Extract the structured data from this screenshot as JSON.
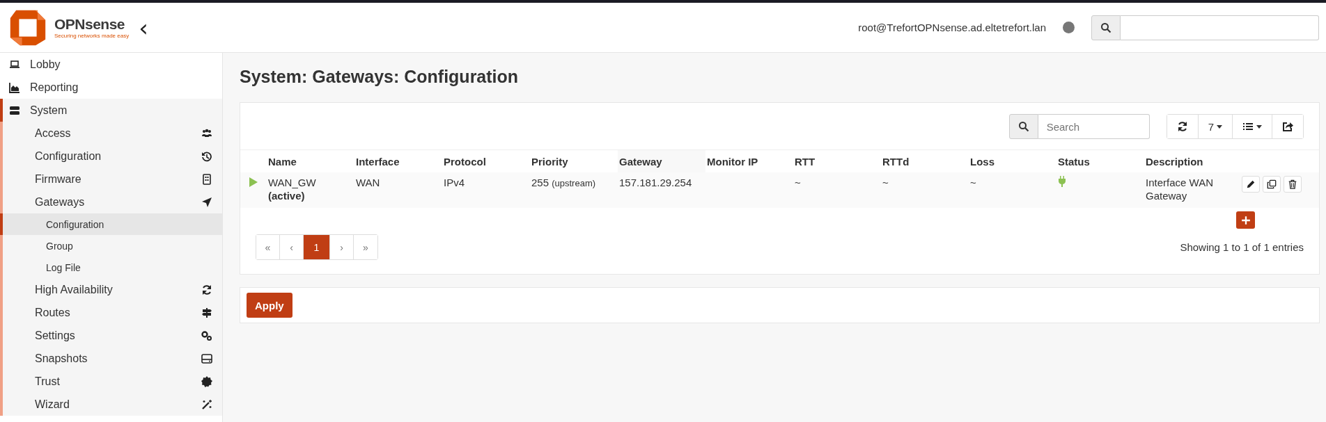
{
  "header": {
    "logo": {
      "name": "OPNsense",
      "tagline": "Securing networks made easy"
    },
    "collapse": "‹",
    "user": "root@TrefortOPNsense.ad.eltetrefort.lan"
  },
  "sidebar": {
    "items": [
      {
        "label": "Lobby",
        "selected": false,
        "expanded": false
      },
      {
        "label": "Reporting",
        "selected": false,
        "expanded": false
      },
      {
        "label": "System",
        "selected": false,
        "expanded": true,
        "children": [
          {
            "label": "Access",
            "selected": false,
            "expanded": false
          },
          {
            "label": "Configuration",
            "selected": false,
            "expanded": false
          },
          {
            "label": "Firmware",
            "selected": false,
            "expanded": false
          },
          {
            "label": "Gateways",
            "selected": false,
            "expanded": true,
            "children": [
              {
                "label": "Configuration",
                "selected": true
              },
              {
                "label": "Group",
                "selected": false
              },
              {
                "label": "Log File",
                "selected": false
              }
            ]
          },
          {
            "label": "High Availability",
            "selected": false,
            "expanded": false
          },
          {
            "label": "Routes",
            "selected": false,
            "expanded": false
          },
          {
            "label": "Settings",
            "selected": false,
            "expanded": false
          },
          {
            "label": "Snapshots",
            "selected": false,
            "expanded": false
          },
          {
            "label": "Trust",
            "selected": false,
            "expanded": false
          },
          {
            "label": "Wizard",
            "selected": false,
            "expanded": false
          }
        ]
      }
    ]
  },
  "page_title": "System: Gateways: Configuration",
  "grid": {
    "search": {
      "placeholder": "Search"
    },
    "page_size": "7",
    "columns": [
      "Name",
      "Interface",
      "Protocol",
      "Priority",
      "Gateway",
      "Monitor IP",
      "RTT",
      "RTTd",
      "Loss",
      "Status",
      "Description"
    ],
    "rows": [
      {
        "enabled": true,
        "name": "WAN_GW",
        "name_note": "(active)",
        "interface": "WAN",
        "protocol": "IPv4",
        "priority": "255",
        "priority_note": "(upstream)",
        "gateway": "157.181.29.254",
        "rtt": "~",
        "rttd": "~",
        "loss": "~",
        "online": true,
        "description": "Interface WAN Gateway"
      }
    ],
    "pagination": [
      {
        "label": "«",
        "selected": false
      },
      {
        "label": "‹",
        "selected": false
      },
      {
        "label": "1",
        "selected": true
      },
      {
        "label": "›",
        "selected": false
      },
      {
        "label": "»",
        "selected": false
      }
    ],
    "info": "Showing 1 to 1 of 1 entries"
  },
  "apply_button": "Apply"
}
